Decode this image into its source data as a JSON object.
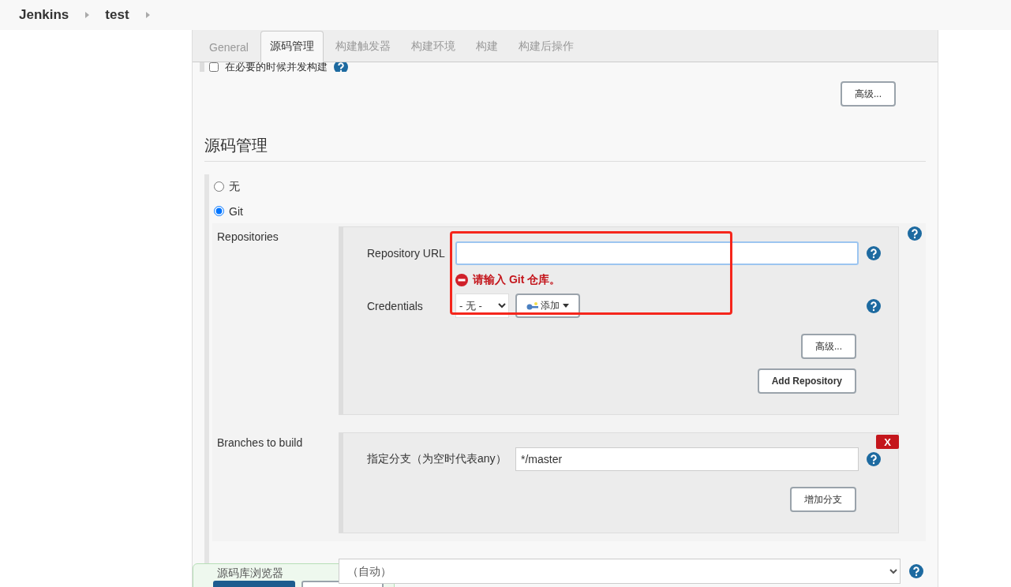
{
  "breadcrumb": [
    "Jenkins",
    "test"
  ],
  "tabs": [
    {
      "label": "General",
      "selected": false
    },
    {
      "label": "源码管理",
      "selected": true
    },
    {
      "label": "构建触发器",
      "selected": false
    },
    {
      "label": "构建环境",
      "selected": false
    },
    {
      "label": "构建",
      "selected": false
    },
    {
      "label": "构建后操作",
      "selected": false
    }
  ],
  "concurrent_option": {
    "label": "在必要的时候并发构建",
    "checked": false
  },
  "advanced_button": "高级...",
  "section_title": "源码管理",
  "scm_options": [
    {
      "label": "无",
      "selected": false
    },
    {
      "label": "Git",
      "selected": true
    }
  ],
  "repositories": {
    "label": "Repositories",
    "url_label": "Repository URL",
    "error": "请输入 Git 仓库。",
    "credentials_label": "Credentials",
    "credentials_value": "- 无 -",
    "add_button": "添加",
    "advanced_button": "高级...",
    "add_repository_button": "Add Repository"
  },
  "branches": {
    "label": "Branches to build",
    "delete_button": "X",
    "spec_label": "指定分支（为空时代表any）",
    "spec_value": "*/master",
    "add_branch_button": "增加分支"
  },
  "browser": {
    "label": "源码库浏览器",
    "value": "（自动）"
  }
}
